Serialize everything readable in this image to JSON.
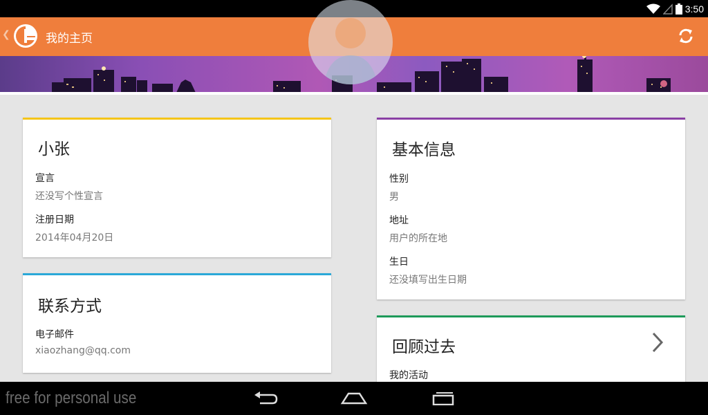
{
  "status_bar": {
    "time": "3:50"
  },
  "action_bar": {
    "title": "我的主页"
  },
  "profile_card": {
    "name": "小张",
    "fields": [
      {
        "label": "宣言",
        "value": "还没写个性宣言"
      },
      {
        "label": "注册日期",
        "value": "2014年04月20日"
      }
    ]
  },
  "contact_card": {
    "title": "联系方式",
    "fields": [
      {
        "label": "电子邮件",
        "value": "xiaozhang@qq.com"
      }
    ]
  },
  "basic_info_card": {
    "title": "基本信息",
    "fields": [
      {
        "label": "性别",
        "value": "男"
      },
      {
        "label": "地址",
        "value": "用户的所在地"
      },
      {
        "label": "生日",
        "value": "还没填写出生日期"
      }
    ]
  },
  "history_card": {
    "title": "回顾过去",
    "fields": [
      {
        "label": "我的活动"
      }
    ]
  },
  "watermark": "free for personal use",
  "colors": {
    "action_bar": "#ef7e3c",
    "profile_accent": "#f5c518",
    "contact_accent": "#2aa8d8",
    "basic_info_accent": "#8a3fa5",
    "history_accent": "#1e9a5a"
  }
}
